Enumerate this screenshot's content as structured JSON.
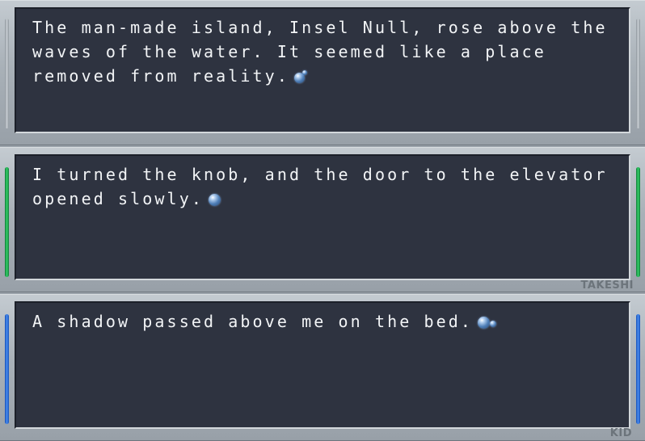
{
  "dialogue": {
    "boxes": [
      {
        "text": "The man-made island, Insel Null, rose above the waves of the water. It seemed like a place removed from reality.",
        "speaker": "",
        "accent_color": "#b5bcc2",
        "indicator_icon": "orb-pair-icon"
      },
      {
        "text": "I turned the knob, and the door to the elevator opened slowly.",
        "speaker": "TAKESHI",
        "accent_color": "#1fb352",
        "indicator_icon": "orb-icon"
      },
      {
        "text": "A shadow passed above me on the bed.",
        "speaker": "KID",
        "accent_color": "#2f72d8",
        "indicator_icon": "orb-trail-icon"
      }
    ]
  }
}
